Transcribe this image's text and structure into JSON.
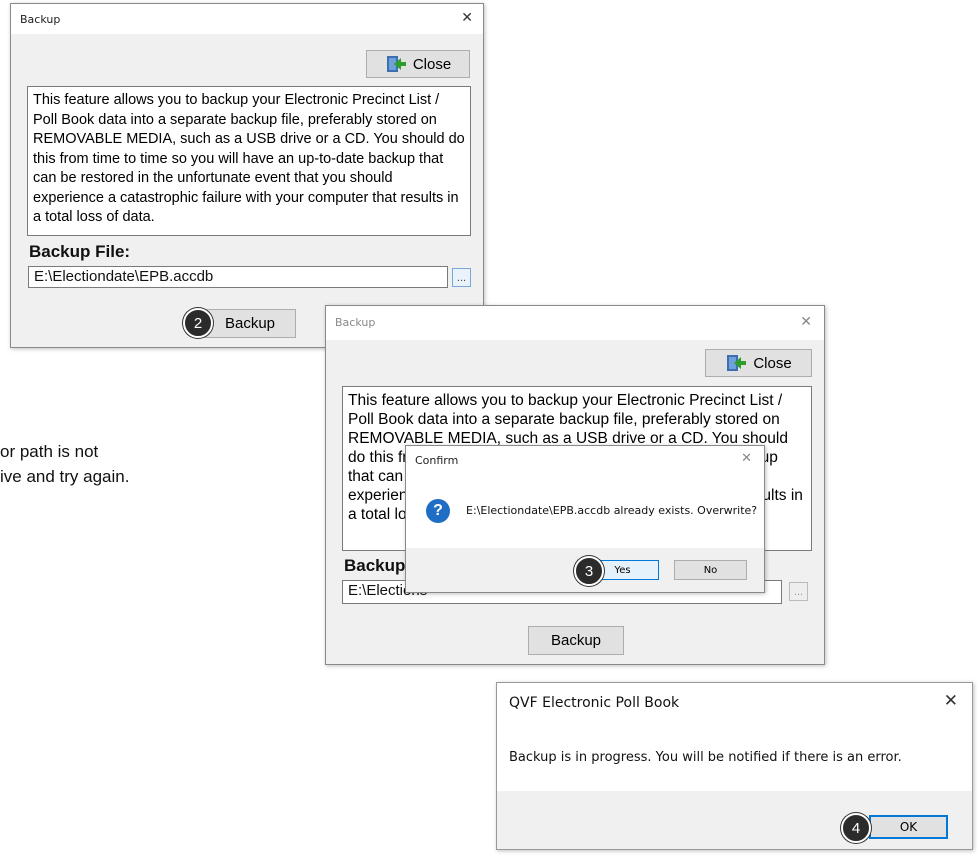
{
  "backup_dialog": {
    "title": "Backup",
    "close_label": "Close",
    "description": "This feature allows you to backup your Electronic Precinct List / Poll Book data into a separate backup file, preferably stored on REMOVABLE MEDIA, such as a USB drive or a CD. You should do this from time to time so you will have an up-to-date backup that can be restored in the unfortunate event that you should experience a catastrophic failure with your computer that results in a total loss of data.",
    "file_label": "Backup File:",
    "file_value": "E:\\Electiondate\\EPB.accdb",
    "browse_label": "...",
    "backup_label": "Backup",
    "step": "2"
  },
  "background_text": {
    "line1": "or path is not",
    "line2": "ive and try again."
  },
  "backup_dialog_2": {
    "title": "Backup",
    "close_label": "Close",
    "file_label": "Backup",
    "file_value": "E:\\Elections",
    "backup_label": "Backup"
  },
  "confirm_dialog": {
    "title": "Confirm",
    "message": "E:\\Electiondate\\EPB.accdb already exists. Overwrite?",
    "yes_label": "Yes",
    "no_label": "No",
    "step": "3"
  },
  "info_dialog": {
    "title": "QVF Electronic Poll Book",
    "message": "Backup is in progress. You will be notified if there is an error.",
    "ok_label": "OK",
    "step": "4"
  }
}
